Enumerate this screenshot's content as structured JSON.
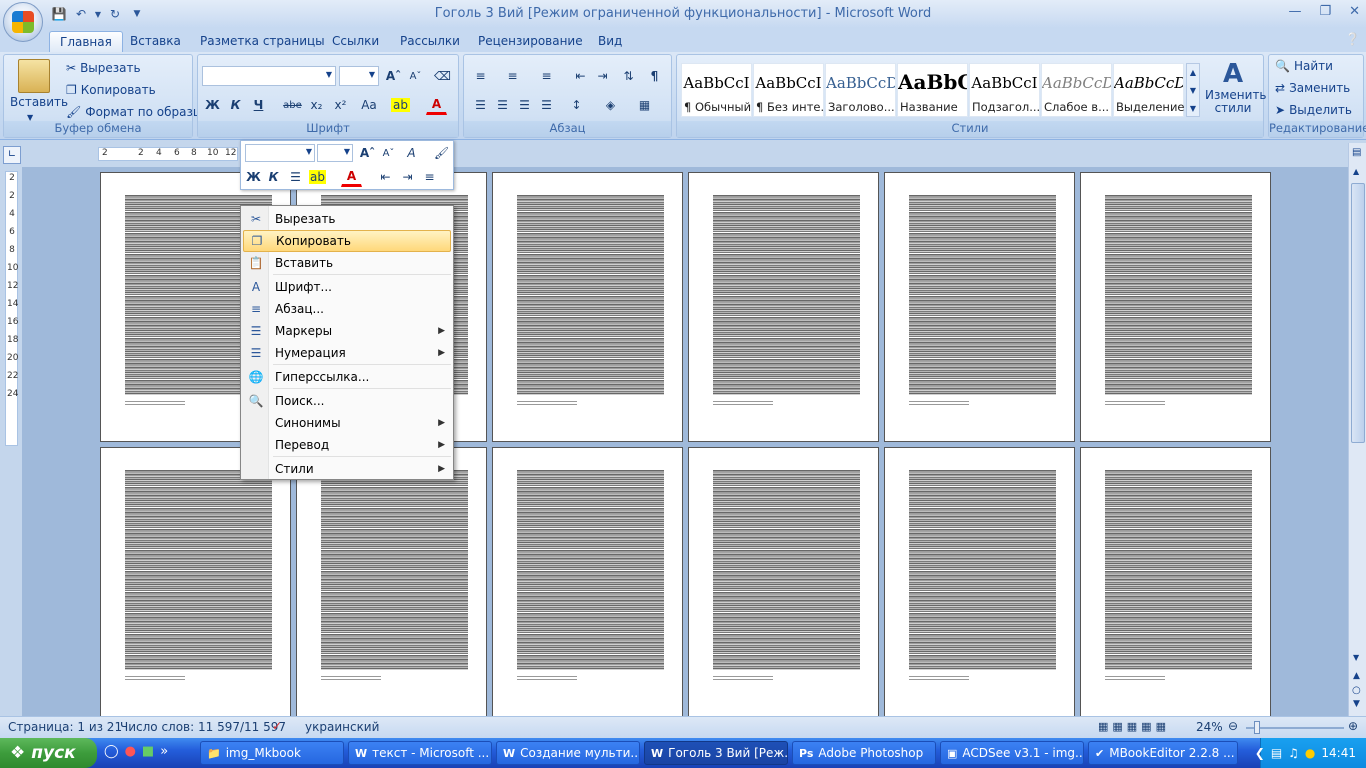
{
  "window": {
    "title": "Гоголь 3 Вий [Режим ограниченной функциональности] - Microsoft Word"
  },
  "tabs": [
    "Главная",
    "Вставка",
    "Разметка страницы",
    "Ссылки",
    "Рассылки",
    "Рецензирование",
    "Вид"
  ],
  "clipboard": {
    "paste": "Вставить",
    "cut": "Вырезать",
    "copy": "Копировать",
    "format_painter": "Формат по образцу",
    "label": "Буфер обмена"
  },
  "font_group": {
    "label": "Шрифт",
    "bold": "Ж",
    "italic": "К",
    "underline": "Ч",
    "strike": "abe",
    "sub": "x₂",
    "sup": "x²",
    "case": "Aa"
  },
  "paragraph_group": {
    "label": "Абзац"
  },
  "styles_group": {
    "label": "Стили",
    "items": [
      {
        "sample": "AaBbCcI",
        "name": "¶ Обычный"
      },
      {
        "sample": "AaBbCcI",
        "name": "¶ Без инте..."
      },
      {
        "sample": "AaBbCcD",
        "name": "Заголово..."
      },
      {
        "sample": "AaBbC",
        "name": "Название"
      },
      {
        "sample": "AaBbCcI",
        "name": "Подзагол..."
      },
      {
        "sample": "AaBbCcD",
        "name": "Слабое в..."
      },
      {
        "sample": "AaBbCcD",
        "name": "Выделение"
      }
    ],
    "change_styles": "Изменить стили"
  },
  "editing": {
    "label": "Редактирование",
    "find": "Найти",
    "replace": "Заменить",
    "select": "Выделить"
  },
  "ruler": {
    "ticks": [
      "2",
      "2",
      "4",
      "6",
      "8",
      "10",
      "12"
    ],
    "vticks": [
      "2",
      "2",
      "4",
      "6",
      "8",
      "10",
      "12",
      "14",
      "16",
      "18",
      "20",
      "22",
      "24"
    ]
  },
  "context_menu": [
    {
      "label": "Вырезать",
      "icon": "scissors-icon",
      "sub": false
    },
    {
      "label": "Копировать",
      "icon": "copy-icon",
      "sub": false,
      "highlight": true
    },
    {
      "label": "Вставить",
      "icon": "paste-icon",
      "sub": false
    },
    {
      "label": "Шрифт...",
      "icon": "font-icon",
      "sub": false
    },
    {
      "label": "Абзац...",
      "icon": "paragraph-icon",
      "sub": false
    },
    {
      "label": "Маркеры",
      "icon": "bullets-icon",
      "sub": true
    },
    {
      "label": "Нумерация",
      "icon": "numbering-icon",
      "sub": true
    },
    {
      "label": "Гиперссылка...",
      "icon": "hyperlink-icon",
      "sub": false
    },
    {
      "label": "Поиск...",
      "icon": "research-icon",
      "sub": false
    },
    {
      "label": "Синонимы",
      "icon": "",
      "sub": true
    },
    {
      "label": "Перевод",
      "icon": "",
      "sub": true
    },
    {
      "label": "Стили",
      "icon": "",
      "sub": true
    }
  ],
  "status": {
    "page": "Страница: 1 из 21",
    "words": "Число слов: 11 597/11 597",
    "language": "украинский",
    "zoom": "24%"
  },
  "taskbar": {
    "start": "пуск",
    "tasks": [
      "img_Mkbook",
      "текст - Microsoft ...",
      "Создание мульти...",
      "Гоголь 3 Вий [Реж...",
      "Adobe Photoshop",
      "ACDSee v3.1 - img...",
      "MBookEditor 2.2.8 ..."
    ],
    "clock": "14:41"
  },
  "colors": {
    "accent": "#15428b",
    "ribbon": "#c5d9f1",
    "highlight": "#ffd87a"
  }
}
